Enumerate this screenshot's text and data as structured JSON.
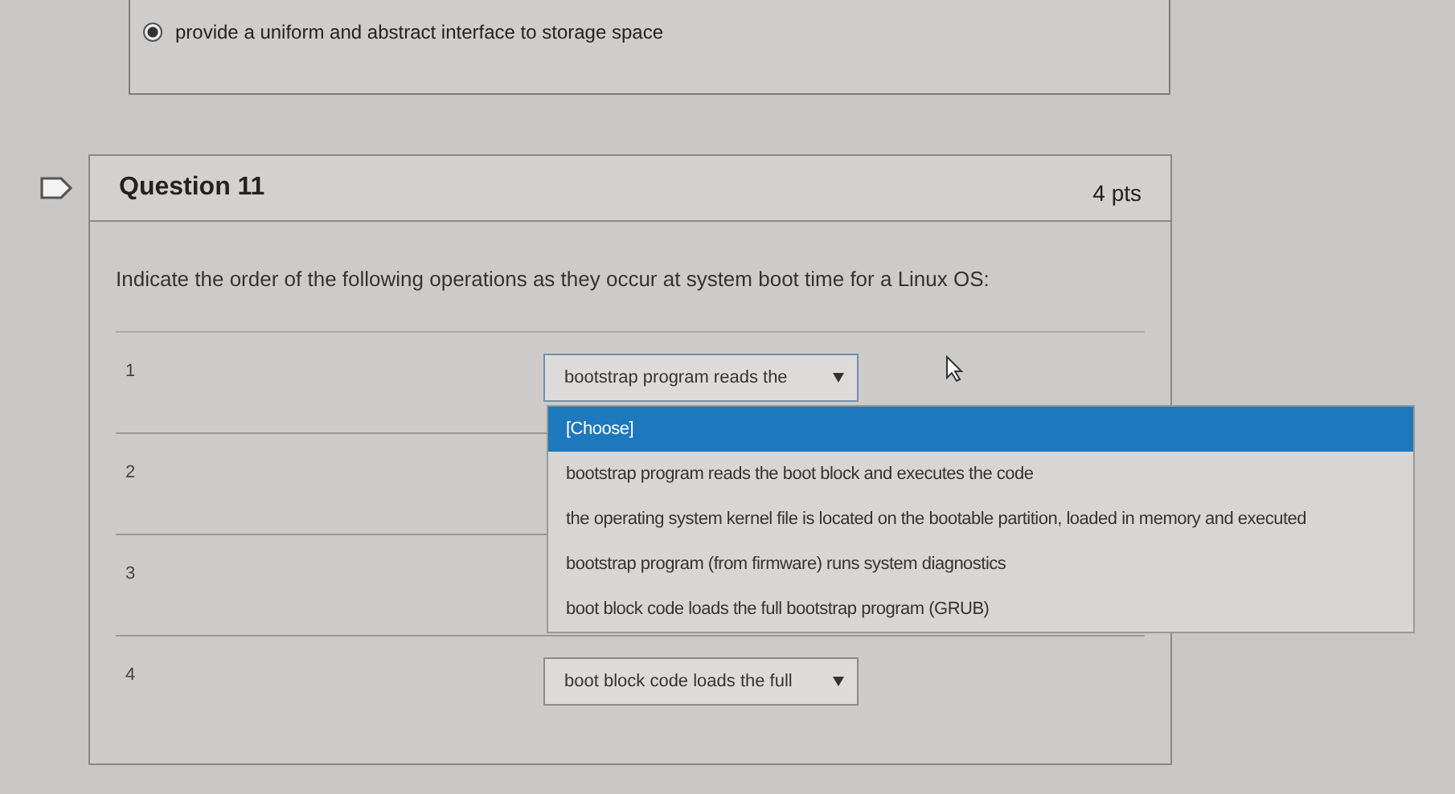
{
  "previous_answer": {
    "label": "provide a uniform and abstract interface to storage space",
    "selected": true
  },
  "question": {
    "title": "Question 11",
    "points": "4 pts",
    "prompt": "Indicate the order of the following operations as they occur at system boot time for a Linux OS:"
  },
  "rows": [
    {
      "number": "1",
      "select": "bootstrap program  reads the",
      "open": true
    },
    {
      "number": "2"
    },
    {
      "number": "3"
    },
    {
      "number": "4",
      "select": "boot block code loads the full",
      "open": false
    }
  ],
  "dropdown_options": [
    {
      "label": "[Choose]",
      "selected": true
    },
    {
      "label": "bootstrap program  reads the boot block and executes the code",
      "selected": false
    },
    {
      "label": "the operating system kernel file is located on the bootable partition, loaded in memory and executed",
      "selected": false
    },
    {
      "label": "bootstrap program (from firmware) runs system diagnostics",
      "selected": false
    },
    {
      "label": "boot block code loads the full bootstrap program (GRUB)",
      "selected": false
    }
  ]
}
